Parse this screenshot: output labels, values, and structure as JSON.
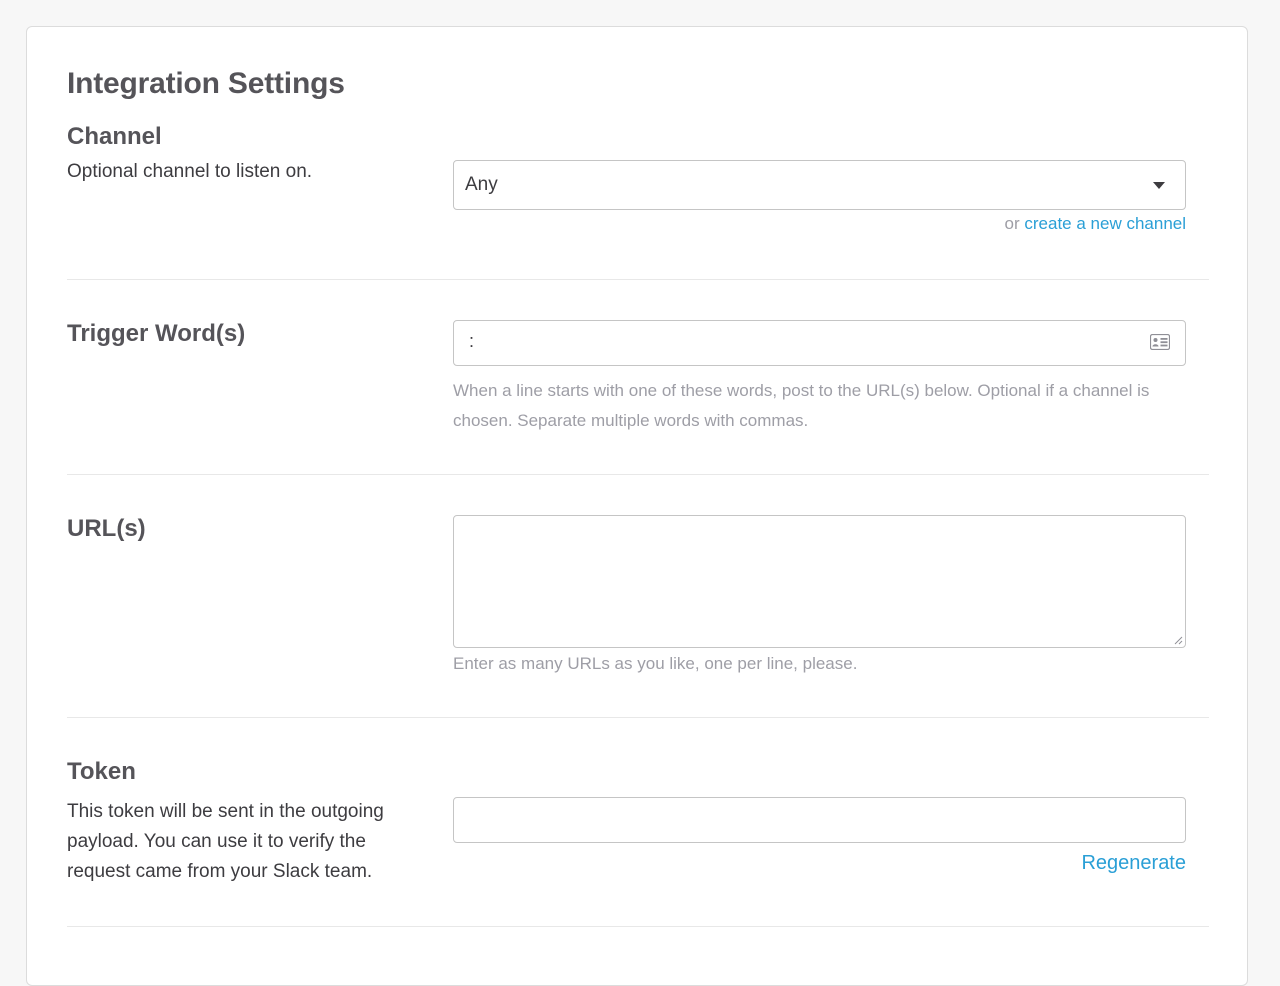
{
  "page": {
    "title": "Integration Settings"
  },
  "channel": {
    "label": "Channel",
    "description": "Optional channel to listen on.",
    "selected": "Any",
    "helper_prefix": "or",
    "create_link": "create a new channel"
  },
  "trigger": {
    "label": "Trigger Word(s)",
    "value": ":",
    "icon": "contact-card-icon",
    "help": "When a line starts with one of these words, post to the URL(s) below. Optional if a channel is chosen. Separate multiple words with commas."
  },
  "urls": {
    "label": "URL(s)",
    "value": "",
    "help": "Enter as many URLs as you like, one per line, please."
  },
  "token": {
    "label": "Token",
    "description": "This token will be sent in the outgoing payload. You can use it to verify the request came from your Slack team.",
    "value": "",
    "regenerate_label": "Regenerate"
  },
  "colors": {
    "link": "#2a9fd6",
    "heading": "#555459",
    "muted": "#9e9ea6"
  }
}
